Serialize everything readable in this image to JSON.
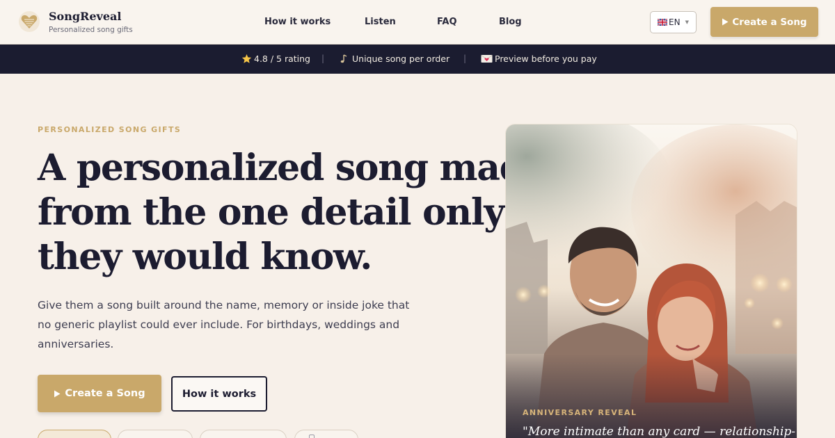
{
  "header": {
    "brand_name": "SongReveal",
    "brand_tagline": "Personalized song gifts",
    "nav": [
      "How it works",
      "Listen",
      "FAQ",
      "Blog"
    ],
    "language": "EN",
    "cta_label": "Create a Song",
    "cta_icon": "play-icon"
  },
  "trust_bar": {
    "items": [
      {
        "icon": "star-icon",
        "text": "4.8 / 5 rating"
      },
      {
        "icon": "music-note-icon",
        "text": "Unique song per order"
      },
      {
        "icon": "love-letter-icon",
        "text": "Preview before you pay"
      }
    ]
  },
  "hero": {
    "eyebrow": "PERSONALIZED SONG GIFTS",
    "headline_lines": [
      "A personalized song made",
      "from the one detail only",
      "they would know."
    ],
    "subcopy_lines": [
      "Give them a song built around the name, memory or inside joke that",
      "no generic playlist could ever include. For birthdays, weddings and",
      "anniversaries."
    ],
    "primary_cta": "Create a Song",
    "secondary_cta": "How it works"
  },
  "card": {
    "label": "ANNIVERSARY REVEAL",
    "quote": "\"More intimate than any card — relationship-"
  },
  "colors": {
    "accent_gold": "#c9a86a",
    "navy": "#1b1c30",
    "background": "#f7f0e9"
  }
}
